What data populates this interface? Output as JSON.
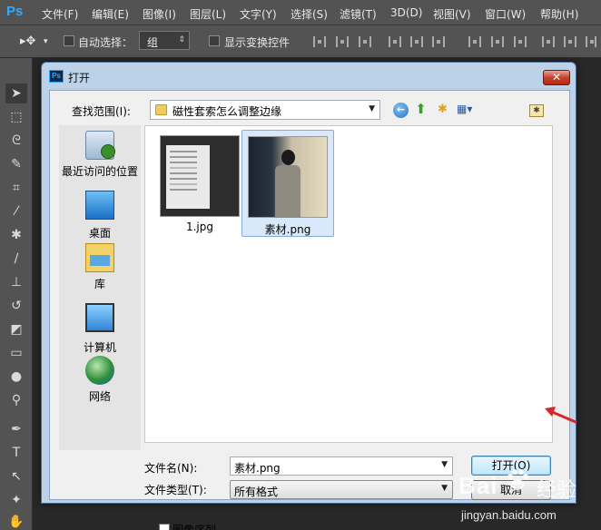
{
  "app": {
    "logo": "Ps",
    "menu": [
      "文件(F)",
      "编辑(E)",
      "图像(I)",
      "图层(L)",
      "文字(Y)",
      "选择(S)",
      "滤镜(T)",
      "3D(D)",
      "视图(V)",
      "窗口(W)",
      "帮助(H)"
    ]
  },
  "options_bar": {
    "auto_select_label": "自动选择：",
    "group_value": "组",
    "show_transform_label": "显示变换控件"
  },
  "dialog": {
    "icon": "Ps",
    "title": "打开",
    "close_glyph": "✕",
    "lookin_label": "查找范围(I):",
    "lookin_value": "磁性套索怎么调整边缘",
    "places": [
      {
        "label": "最近访问的位置",
        "icon": "recent-places-icon"
      },
      {
        "label": "桌面",
        "icon": "desktop-icon"
      },
      {
        "label": "库",
        "icon": "library-icon"
      },
      {
        "label": "计算机",
        "icon": "computer-icon"
      },
      {
        "label": "网络",
        "icon": "network-icon"
      }
    ],
    "files": [
      {
        "name": "1.jpg",
        "selected": false
      },
      {
        "name": "素材.png",
        "selected": true
      }
    ],
    "filename_label": "文件名(N):",
    "filename_value": "素材.png",
    "filetype_label": "文件类型(T):",
    "filetype_value": "所有格式",
    "open_button": "打开(O)",
    "cancel_button": "取消",
    "image_sequence_label": "图像序列"
  },
  "watermark": {
    "brand": "Bai",
    "brand_cn": "经验",
    "url": "jingyan.baidu.com"
  },
  "colors": {
    "ps_panel": "#535353",
    "canvas_bg": "#282828",
    "dialog_frame": "#bcd2e9",
    "annotation_arrow": "#d8262d"
  }
}
